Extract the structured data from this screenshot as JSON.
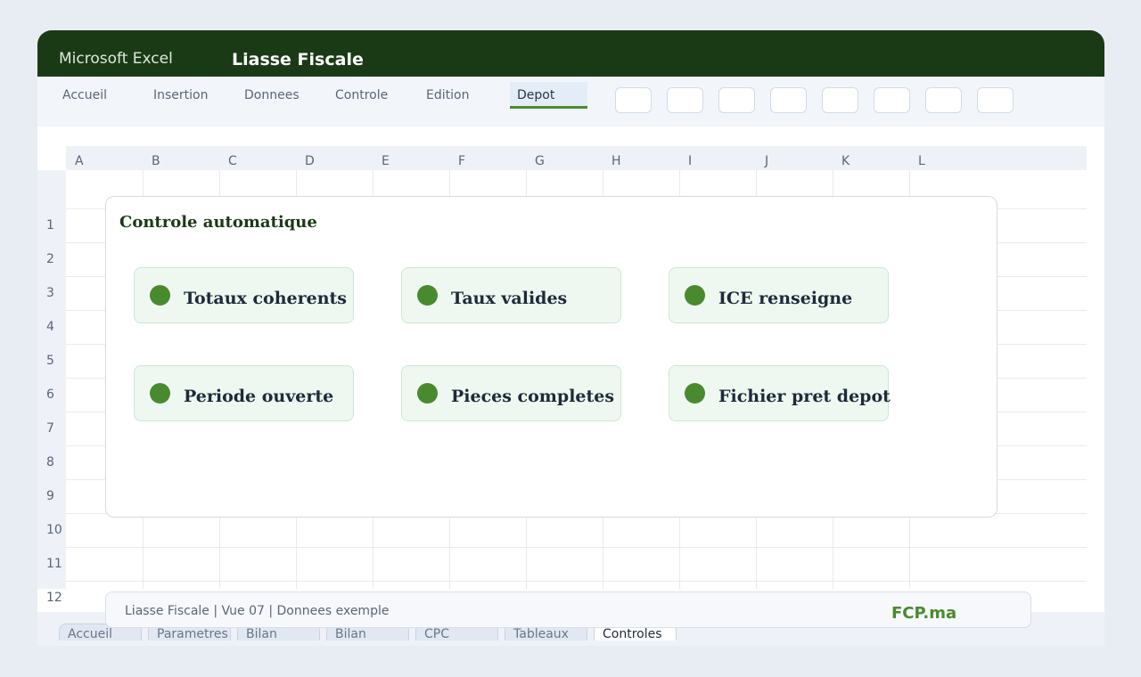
{
  "window": {
    "app_name": "Microsoft Excel",
    "doc_title": "Liasse Fiscale"
  },
  "ribbon": {
    "tabs": [
      {
        "label": "Accueil"
      },
      {
        "label": "Insertion"
      },
      {
        "label": "Donnees"
      },
      {
        "label": "Controle"
      },
      {
        "label": "Edition"
      },
      {
        "label": "Depot",
        "active": true
      }
    ],
    "button_count": 8
  },
  "grid": {
    "columns": [
      "A",
      "B",
      "C",
      "D",
      "E",
      "F",
      "G",
      "H",
      "I",
      "J",
      "K",
      "L"
    ],
    "rows": [
      "1",
      "2",
      "3",
      "4",
      "5",
      "6",
      "7",
      "8",
      "9",
      "10",
      "11",
      "12"
    ]
  },
  "panel": {
    "title": "Controle automatique",
    "checks": [
      {
        "label": "Totaux coherents",
        "status": "ok"
      },
      {
        "label": "Taux valides",
        "status": "ok"
      },
      {
        "label": "ICE renseigne",
        "status": "ok"
      },
      {
        "label": "Periode ouverte",
        "status": "ok"
      },
      {
        "label": "Pieces completes",
        "status": "ok"
      },
      {
        "label": "Fichier pret depot",
        "status": "ok"
      }
    ]
  },
  "status": {
    "text": "Liasse Fiscale | Vue 07 | Donnees exemple",
    "brand": "FCP.ma"
  },
  "sheet_tabs": [
    {
      "label": "Accueil"
    },
    {
      "label": "Parametres"
    },
    {
      "label": "Bilan"
    },
    {
      "label": "Bilan"
    },
    {
      "label": "CPC"
    },
    {
      "label": "Tableaux"
    },
    {
      "label": "Controles",
      "active": true
    }
  ],
  "colors": {
    "title_bar": "#1a3a16",
    "accent_green": "#4a8a2e",
    "check_bg": "#eef8f1",
    "page_bg": "#e8edf4"
  }
}
